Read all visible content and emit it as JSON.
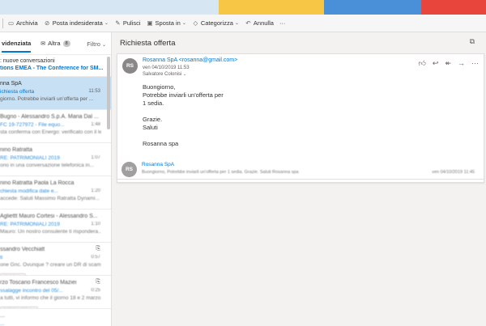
{
  "toolbar": {
    "archive": "Archivia",
    "junk": "Posta indesiderata",
    "sweep": "Pulisci",
    "move": "Sposta in",
    "categorize": "Categorizza",
    "undo": "Annulla",
    "more": "···"
  },
  "list": {
    "tab_focused": "videnziata",
    "tab_other": "Altra",
    "other_count": "8",
    "filter": "Filtro",
    "new_conversations": "nuove conversazioni",
    "emea": "tions EMEA - The Conference for SM...",
    "messages": [
      {
        "sender": "nna SpA",
        "subject": "ichiesta offerta",
        "preview": "giorno. Potrebbe inviarli un'offerta per ...",
        "time": "11:53",
        "selected": true
      },
      {
        "sender": "Bugno - Alessandro S.p.A. Maria Dal ...",
        "subject": "FC 19-727972 - File equo...",
        "preview": "sta conferma con Energo: verificato con il legs...",
        "time": "1:48"
      },
      {
        "sender": "nino Ratratta",
        "subject": "RE: PATRIMONIALI 2019",
        "preview": "ono in una conversazione telefonica in...",
        "time": "1:07"
      },
      {
        "sender": "nino Ratratta  Paola La Rocca",
        "subject": "chiesta modifica date e...",
        "preview": "accede: Saluti Massimo Ratratta Dynami...",
        "time": "1:20"
      },
      {
        "sender": "Agliettt Mauro Cortesi - Alessandro S...",
        "subject": "RE: PATRIMONIALI 2019",
        "preview": "Mauro: Un nostro consulente ti rispondera...",
        "time": "1:10"
      },
      {
        "sender": "ssandro Vecchiatt",
        "subject": "ti",
        "preview": "one Gnc. Ovunque ? creare un DR di scambio...",
        "time": "0:57",
        "chip": "MAOC N..."
      },
      {
        "sender": "rzo Toscano  Francesco Maziei",
        "subject": "ssalagge incontro del 05/...",
        "preview": "a tutti, vi informo che il giorno 18 e 2 marzo...",
        "time": "0:25",
        "chip": "CODICA APO 1..."
      },
      {
        "sender": "...",
        "subject": "...",
        "preview": "...",
        "time": ""
      }
    ]
  },
  "reading": {
    "subject": "Richiesta offerta",
    "avatar_initials": "RS",
    "from": "Rosanna SpA <rosanna@gmail.com>",
    "date": "ven 04/10/2019 11:53",
    "to": "Salvatore Colonisi",
    "body": [
      "Buongiorno,",
      "Potrebbe inviarli un'offerta per",
      "1 sedia.",
      "Grazie.",
      "Saluti",
      "Rosanna spa"
    ],
    "second": {
      "avatar_initials": "RS",
      "from": "Rosanna SpA",
      "preview": "Buongiorno, Potrebbe inviarli un'offerta per 1 sedia. Grazie. Saluti Rosanna spa",
      "date": "ven 04/10/2019 11:45"
    }
  },
  "colors": {
    "accent": "#0078d4",
    "selected": "#c7e0f4"
  }
}
